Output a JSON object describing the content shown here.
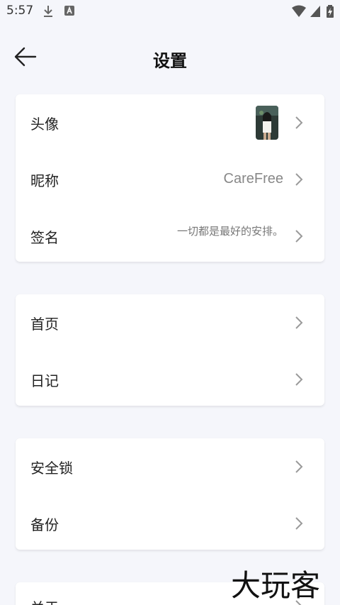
{
  "status_bar": {
    "time": "5:57"
  },
  "header": {
    "title": "设置"
  },
  "profile_card": {
    "avatar_label": "头像",
    "nickname_label": "昵称",
    "nickname_value": "CareFree",
    "signature_label": "签名",
    "signature_value": "一切都是最好的安排。"
  },
  "nav_card": {
    "home_label": "首页",
    "diary_label": "日记"
  },
  "security_card": {
    "lock_label": "安全锁",
    "backup_label": "备份"
  },
  "about_card": {
    "partial_label": "关于"
  },
  "watermark": "大玩客",
  "colors": {
    "background": "#f5f6fb",
    "card": "#ffffff",
    "chevron": "#9a9a9a",
    "text": "#222222",
    "muted": "#888888"
  }
}
